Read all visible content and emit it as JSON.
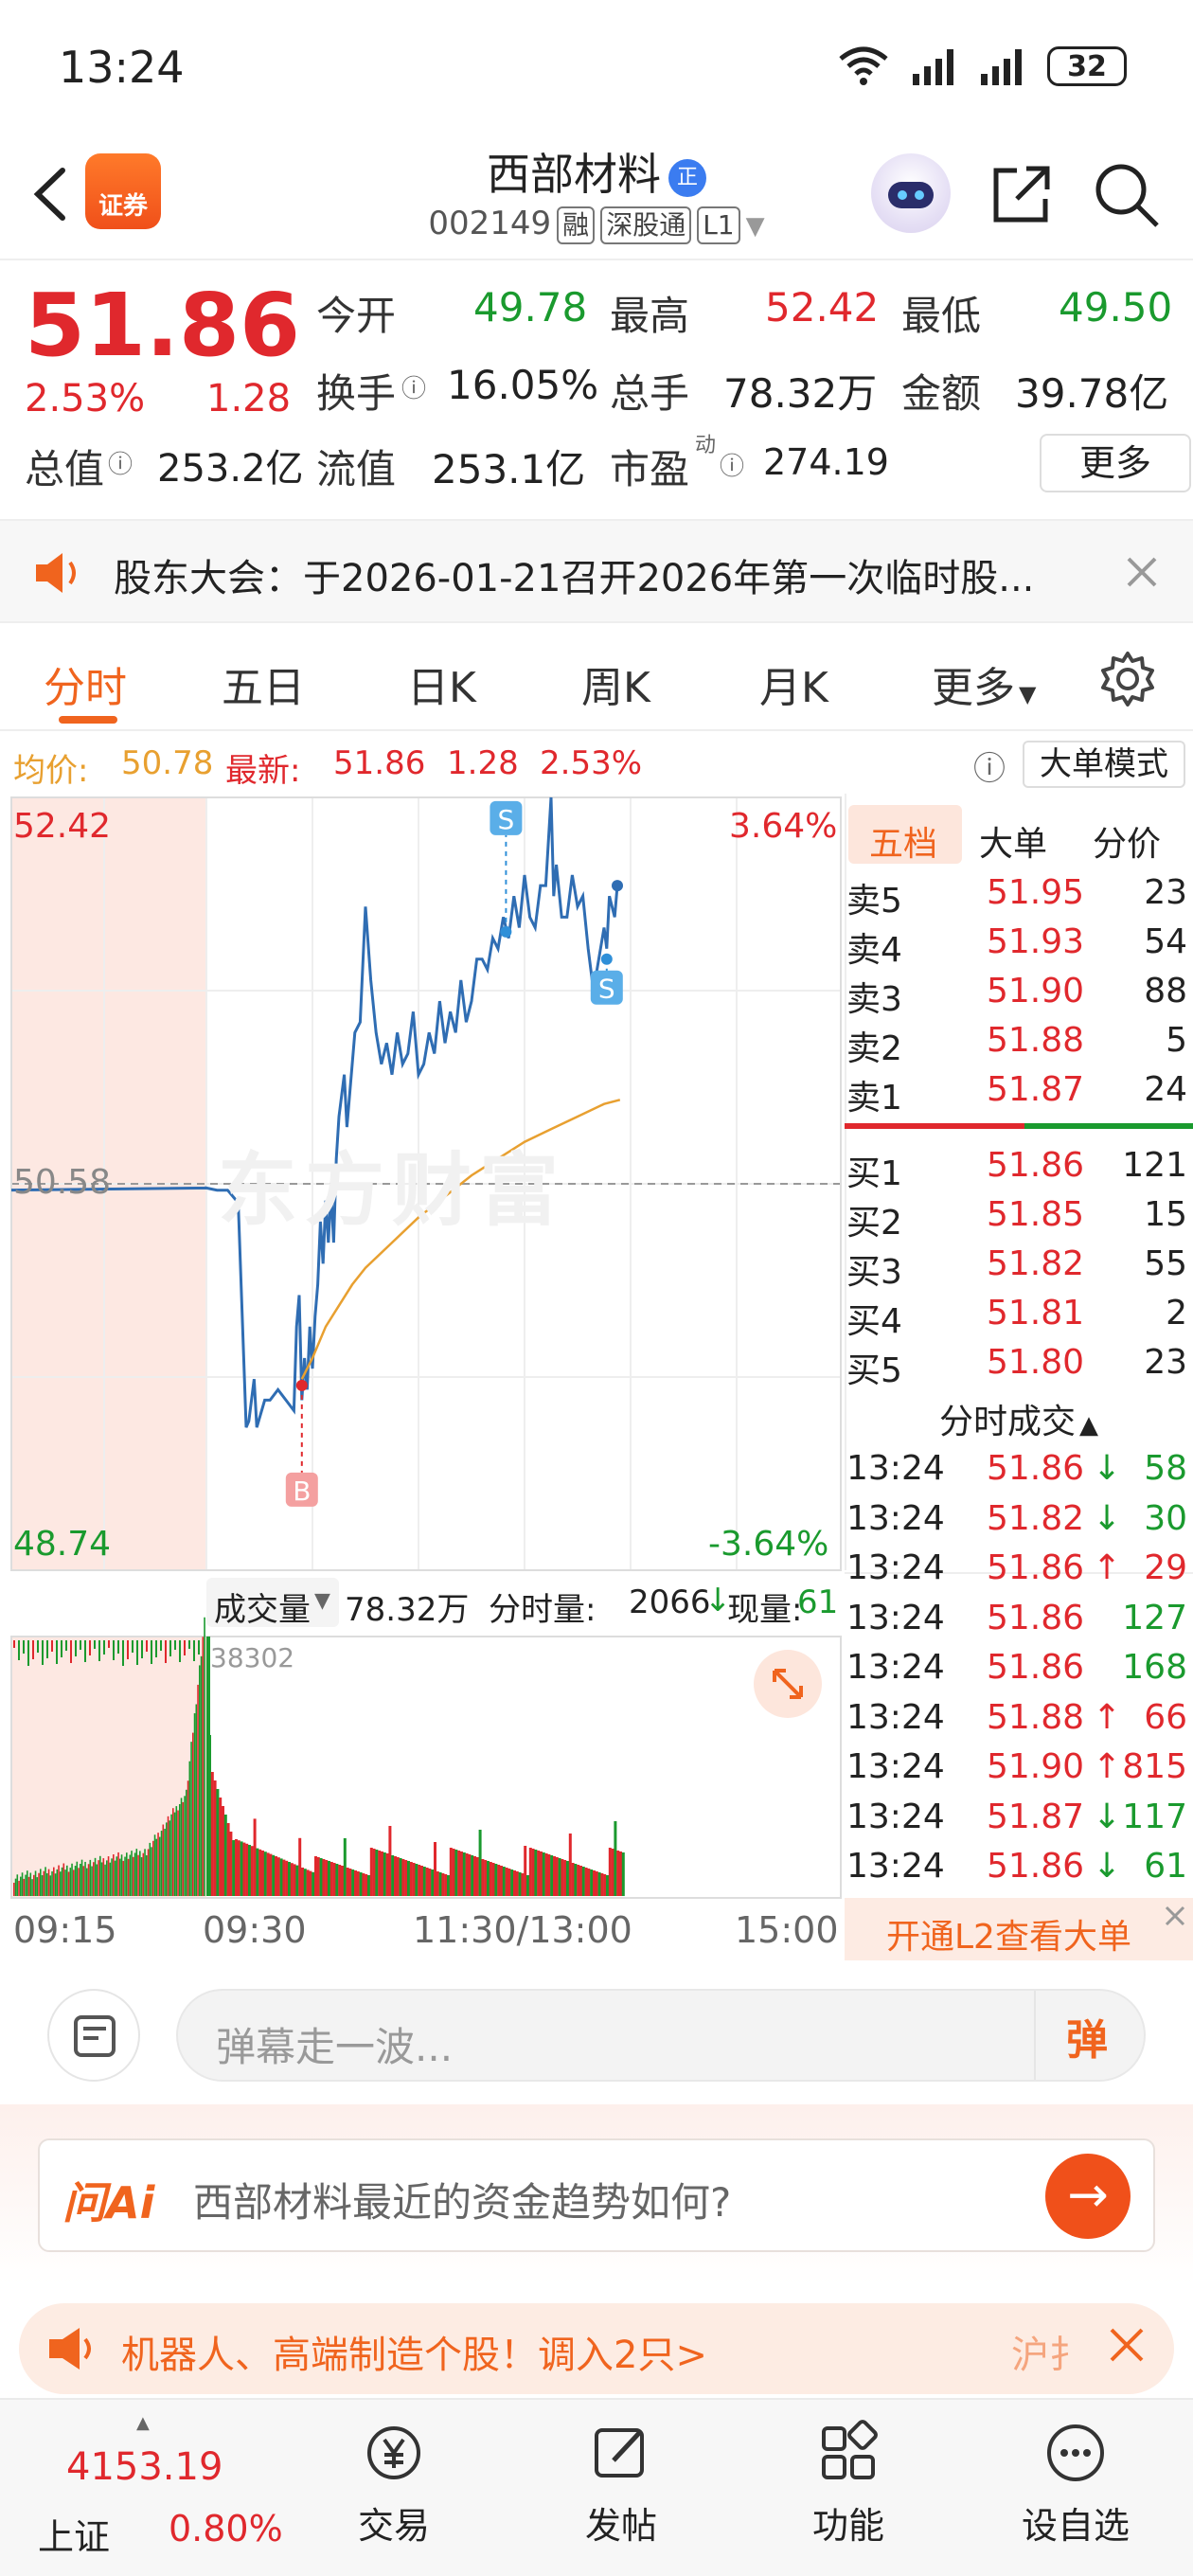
{
  "status_bar": {
    "time": "13:24",
    "battery": "32"
  },
  "header": {
    "app_badge": "证券",
    "stock_name": "西部材料",
    "name_badge": "正",
    "code": "002149",
    "tags": [
      "融",
      "深股通",
      "L1"
    ]
  },
  "quote": {
    "price": "51.86",
    "change_pct": "2.53%",
    "change": "1.28",
    "open_label": "今开",
    "open": "49.78",
    "high_label": "最高",
    "high": "52.42",
    "low_label": "最低",
    "low": "49.50",
    "turnover_label": "换手",
    "turnover": "16.05%",
    "volume_label": "总手",
    "volume": "78.32万",
    "amount_label": "金额",
    "amount": "39.78亿",
    "mcap_label": "总值",
    "mcap": "253.2亿",
    "float_label": "流值",
    "float_cap": "253.1亿",
    "pe_label": "市盈",
    "pe_sup": "动",
    "pe": "274.19",
    "more_label": "更多"
  },
  "notice": {
    "text": "股东大会：于2026-01-21召开2026年第一次临时股..."
  },
  "tabs": [
    "分时",
    "五日",
    "日K",
    "周K",
    "月K",
    "更多"
  ],
  "avg_bar": {
    "avg_label": "均价:",
    "avg": "50.78",
    "latest_label": "最新:",
    "latest": "51.86",
    "latest_change": "1.28",
    "latest_pct": "2.53%",
    "big_order_mode": "大单模式"
  },
  "chart_data": {
    "type": "line",
    "title": "",
    "y_high_label": "52.42",
    "y_low_label": "48.74",
    "prev_close_label": "50.58",
    "pct_high_label": "3.64%",
    "pct_low_label": "-3.64%",
    "ylim": [
      48.74,
      52.42
    ],
    "x_tick_labels": [
      "09:15",
      "09:30",
      "11:30/13:00",
      "15:00"
    ],
    "series": [
      {
        "values_time_price": [
          [
            0,
            50.56
          ],
          [
            4,
            50.55
          ],
          [
            8,
            50.55
          ],
          [
            12,
            50.49
          ],
          [
            15,
            49.42
          ],
          [
            16,
            49.45
          ],
          [
            18,
            49.65
          ],
          [
            19,
            49.42
          ],
          [
            22,
            49.55
          ],
          [
            24,
            49.55
          ],
          [
            27,
            49.6
          ],
          [
            30,
            49.55
          ],
          [
            33,
            49.5
          ],
          [
            34,
            49.9
          ],
          [
            35,
            50.05
          ],
          [
            36,
            49.55
          ],
          [
            37,
            49.75
          ],
          [
            38,
            49.6
          ],
          [
            39,
            49.9
          ],
          [
            40,
            49.7
          ],
          [
            41,
            49.95
          ],
          [
            42,
            50.1
          ],
          [
            43,
            50.4
          ],
          [
            44,
            50.2
          ],
          [
            45,
            50.5
          ],
          [
            46,
            50.3
          ],
          [
            47,
            50.55
          ],
          [
            48,
            50.3
          ],
          [
            49,
            50.7
          ],
          [
            50,
            50.9
          ],
          [
            52,
            51.1
          ],
          [
            53,
            50.85
          ],
          [
            54,
            51.0
          ],
          [
            56,
            51.3
          ],
          [
            58,
            51.35
          ],
          [
            60,
            51.9
          ],
          [
            62,
            51.55
          ],
          [
            64,
            51.3
          ],
          [
            66,
            51.15
          ],
          [
            68,
            51.25
          ],
          [
            70,
            51.1
          ],
          [
            72,
            51.3
          ],
          [
            74,
            51.15
          ],
          [
            76,
            51.2
          ],
          [
            78,
            51.4
          ],
          [
            80,
            51.1
          ],
          [
            82,
            51.15
          ],
          [
            84,
            51.3
          ],
          [
            86,
            51.2
          ],
          [
            88,
            51.45
          ],
          [
            90,
            51.25
          ],
          [
            92,
            51.4
          ],
          [
            94,
            51.3
          ],
          [
            96,
            51.55
          ],
          [
            98,
            51.35
          ],
          [
            100,
            51.45
          ],
          [
            102,
            51.65
          ],
          [
            104,
            51.65
          ],
          [
            106,
            51.6
          ],
          [
            108,
            51.75
          ],
          [
            110,
            51.7
          ],
          [
            112,
            51.85
          ],
          [
            114,
            51.75
          ],
          [
            116,
            51.95
          ],
          [
            118,
            51.8
          ],
          [
            120,
            52.05
          ],
          [
            122,
            51.85
          ],
          [
            124,
            51.8
          ],
          [
            126,
            52.0
          ],
          [
            128,
            52.0
          ],
          [
            130,
            52.42
          ],
          [
            131,
            51.95
          ],
          [
            132,
            52.1
          ],
          [
            134,
            51.85
          ],
          [
            136,
            51.85
          ],
          [
            138,
            52.05
          ],
          [
            140,
            51.9
          ],
          [
            142,
            51.95
          ],
          [
            144,
            51.7
          ],
          [
            146,
            51.5
          ],
          [
            148,
            51.65
          ],
          [
            150,
            51.8
          ],
          [
            151,
            51.7
          ],
          [
            152,
            51.95
          ],
          [
            154,
            51.85
          ],
          [
            155,
            52.0
          ]
        ]
      },
      {
        "values_time_price": [
          [
            36,
            49.65
          ],
          [
            40,
            49.75
          ],
          [
            45,
            49.9
          ],
          [
            50,
            50.0
          ],
          [
            55,
            50.1
          ],
          [
            60,
            50.18
          ],
          [
            70,
            50.3
          ],
          [
            80,
            50.42
          ],
          [
            90,
            50.52
          ],
          [
            100,
            50.62
          ],
          [
            110,
            50.7
          ],
          [
            120,
            50.78
          ],
          [
            130,
            50.84
          ],
          [
            140,
            50.9
          ],
          [
            150,
            50.96
          ],
          [
            156,
            50.98
          ]
        ]
      }
    ],
    "markers": [
      {
        "label": "B",
        "time": 36,
        "price": 49.62
      },
      {
        "label": "S",
        "time": 113,
        "price": 51.78
      },
      {
        "label": "S",
        "time": 151,
        "price": 51.65
      }
    ]
  },
  "volume": {
    "label": "成交量",
    "total": "78.32万",
    "minute_label": "分时量:",
    "minute_value": "2066",
    "now_label": "现量:",
    "now_value": "61",
    "peak_label": "38302"
  },
  "order_book": {
    "tabs": [
      "五档",
      "大单",
      "分价"
    ],
    "asks": [
      {
        "name": "卖5",
        "price": "51.95",
        "vol": "23"
      },
      {
        "name": "卖4",
        "price": "51.93",
        "vol": "54"
      },
      {
        "name": "卖3",
        "price": "51.90",
        "vol": "88"
      },
      {
        "name": "卖2",
        "price": "51.88",
        "vol": "5"
      },
      {
        "name": "卖1",
        "price": "51.87",
        "vol": "24"
      }
    ],
    "bids": [
      {
        "name": "买1",
        "price": "51.86",
        "vol": "121"
      },
      {
        "name": "买2",
        "price": "51.85",
        "vol": "15"
      },
      {
        "name": "买3",
        "price": "51.82",
        "vol": "55"
      },
      {
        "name": "买4",
        "price": "51.81",
        "vol": "2"
      },
      {
        "name": "买5",
        "price": "51.80",
        "vol": "23"
      }
    ],
    "ticks_title": "分时成交",
    "ticks": [
      {
        "time": "13:24",
        "price": "51.86",
        "arrow": "↓",
        "vol": "58"
      },
      {
        "time": "13:24",
        "price": "51.82",
        "arrow": "↓",
        "vol": "30"
      },
      {
        "time": "13:24",
        "price": "51.86",
        "arrow": "↑",
        "vol": "29"
      },
      {
        "time": "13:24",
        "price": "51.86",
        "arrow": "",
        "vol": "127"
      },
      {
        "time": "13:24",
        "price": "51.86",
        "arrow": "",
        "vol": "168"
      },
      {
        "time": "13:24",
        "price": "51.88",
        "arrow": "↑",
        "vol": "66"
      },
      {
        "time": "13:24",
        "price": "51.90",
        "arrow": "↑",
        "vol": "815"
      },
      {
        "time": "13:24",
        "price": "51.87",
        "arrow": "↓",
        "vol": "117"
      },
      {
        "time": "13:24",
        "price": "51.86",
        "arrow": "↓",
        "vol": "61"
      }
    ],
    "l2_cta": "开通L2查看大单"
  },
  "danmu": {
    "placeholder": "弹幕走一波...",
    "button": "弹"
  },
  "ai": {
    "logo": "问Ai",
    "question": "西部材料最近的资金趋势如何?"
  },
  "promo": {
    "text": "机器人、高端制造个股！调入2只>",
    "side": "沪扌"
  },
  "bottom_nav": {
    "index_value": "4153.19",
    "index_name": "上证",
    "index_pct": "0.80%",
    "items": [
      "交易",
      "发帖",
      "功能",
      "设自选"
    ]
  },
  "colors": {
    "up": "#e0282d",
    "down": "#1a9a2e",
    "accent": "#f0641e",
    "price_line": "#2f6db3",
    "avg_line": "#e8a030"
  }
}
